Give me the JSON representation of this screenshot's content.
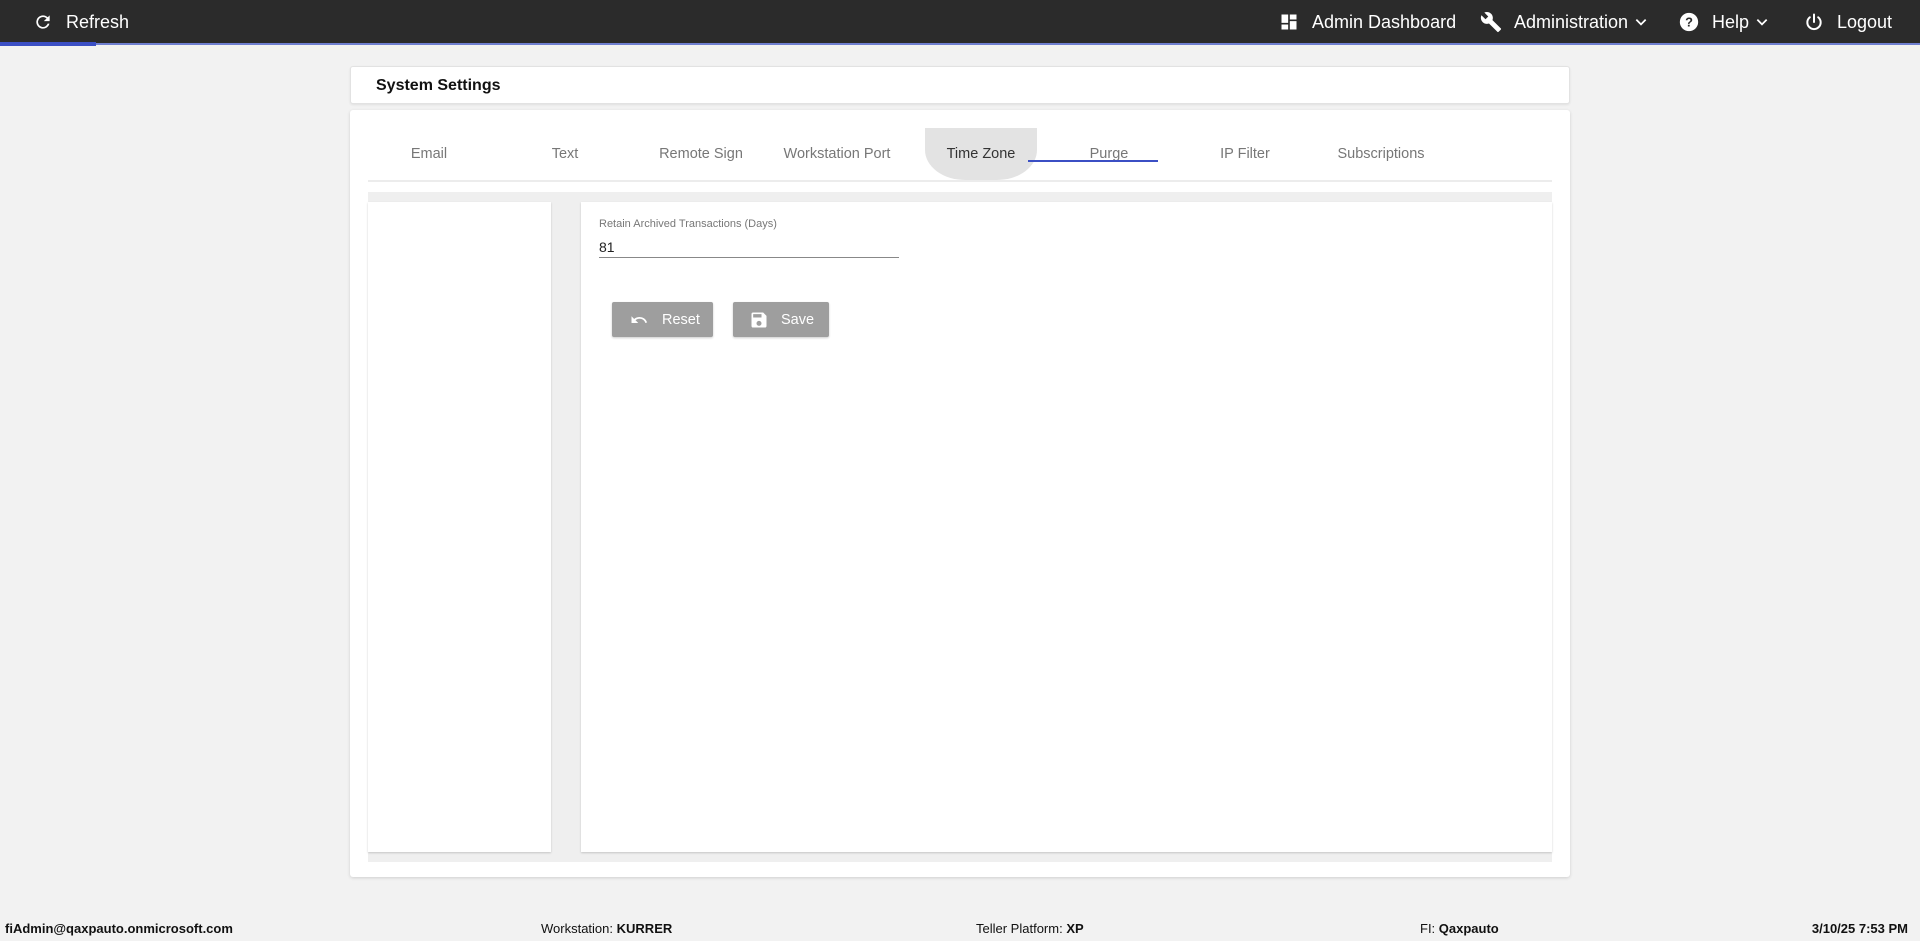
{
  "topbar": {
    "refresh_label": "Refresh",
    "admin_dashboard_label": "Admin Dashboard",
    "administration_label": "Administration",
    "help_label": "Help",
    "logout_label": "Logout",
    "progress_fraction": 0.05
  },
  "page": {
    "title": "System Settings"
  },
  "tabs": [
    {
      "label": "Email"
    },
    {
      "label": "Text"
    },
    {
      "label": "Remote Sign"
    },
    {
      "label": "Workstation Port"
    },
    {
      "label": "Time Zone"
    },
    {
      "label": "Purge"
    },
    {
      "label": "IP Filter"
    },
    {
      "label": "Subscriptions"
    }
  ],
  "active_tab": "Purge",
  "form": {
    "retain_label": "Retain Archived Transactions (Days)",
    "retain_value": "81"
  },
  "buttons": {
    "reset_label": "Reset",
    "save_label": "Save"
  },
  "footer": {
    "user": "fiAdmin@qaxpauto.onmicrosoft.com",
    "workstation_label": "Workstation:",
    "workstation_value": "KURRER",
    "teller_label": "Teller Platform:",
    "teller_value": "XP",
    "fi_label": "FI:",
    "fi_value": "Qaxpauto",
    "datetime": "3/10/25 7:53 PM"
  },
  "colors": {
    "topbar_bg": "#2b2b2b",
    "accent": "#3b4fc4",
    "button_bg": "#9e9e9e"
  }
}
